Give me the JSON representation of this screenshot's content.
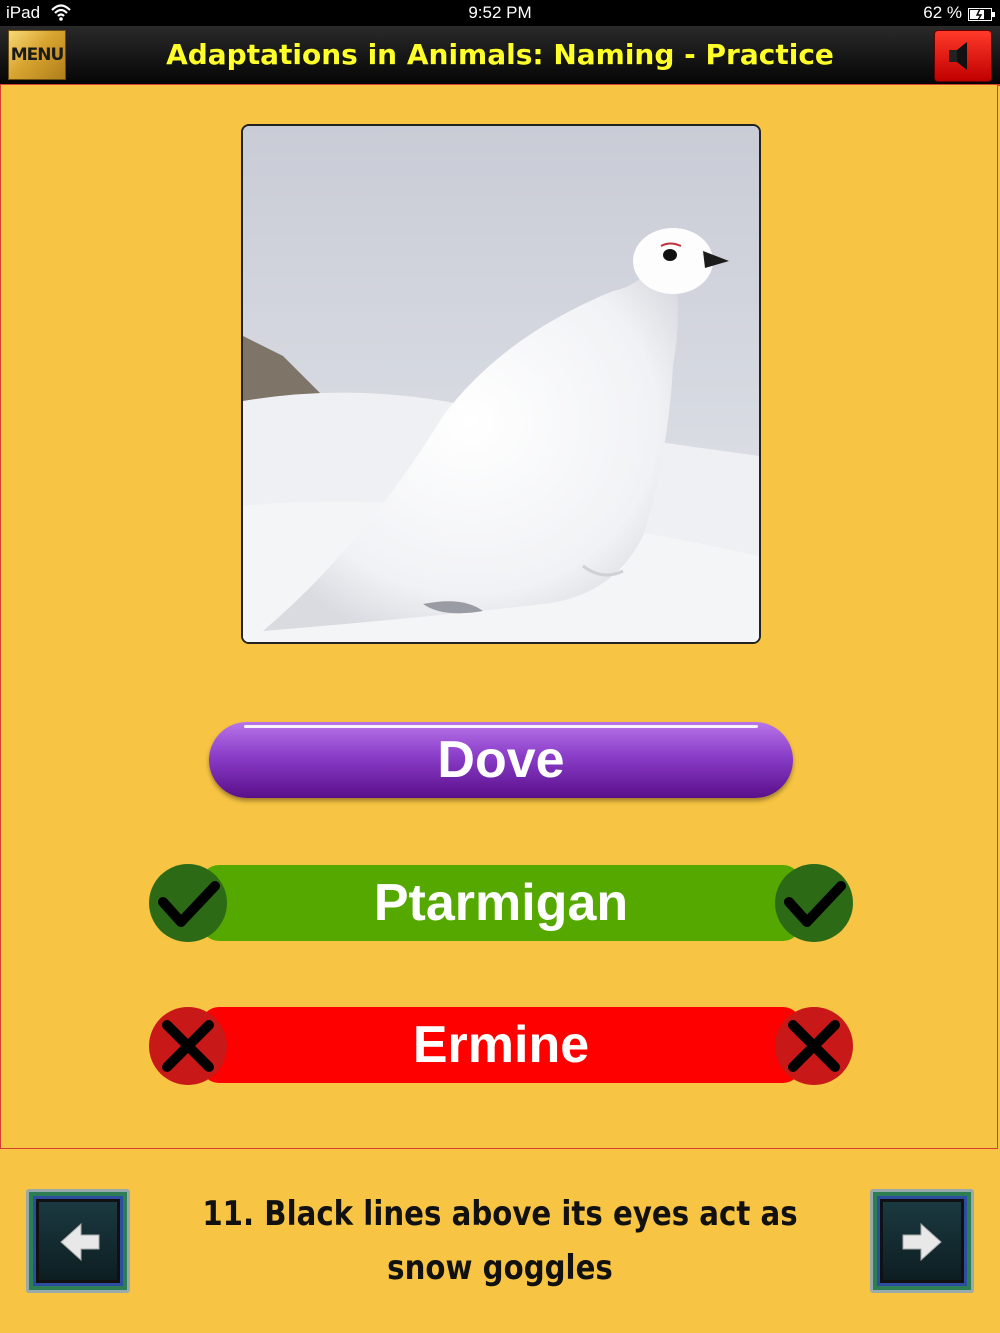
{
  "status_bar": {
    "device": "iPad",
    "time": "9:52 PM",
    "battery_percent": "62 %"
  },
  "header": {
    "menu_label": "MENU",
    "title": "Adaptations in Animals:  Naming - Practice",
    "sound_icon": "speaker-muted-icon"
  },
  "photo": {
    "subject": "white ptarmigan in snow"
  },
  "answers": [
    {
      "label": "Dove",
      "state": "unselected",
      "color": "#8a3dc8"
    },
    {
      "label": "Ptarmigan",
      "state": "correct",
      "color": "#54a800",
      "icon": "checkmark-icon"
    },
    {
      "label": "Ermine",
      "state": "incorrect",
      "color": "#ff0000",
      "icon": "x-icon"
    }
  ],
  "footer": {
    "clue_line1": "11. Black lines above its eyes act as",
    "clue_line2": "snow goggles",
    "prev_icon": "arrow-left-icon",
    "next_icon": "arrow-right-icon"
  },
  "colors": {
    "background": "#f7c443",
    "title_text": "#ffff2a",
    "accent_border": "#d64030"
  }
}
